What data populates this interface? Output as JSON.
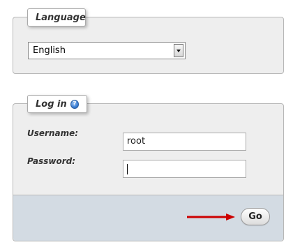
{
  "language_section": {
    "legend": "Language",
    "select": {
      "selected_value": "English"
    }
  },
  "login_section": {
    "legend": "Log in",
    "help_icon_glyph": "?",
    "username": {
      "label": "Username:",
      "value": "root"
    },
    "password": {
      "label": "Password:",
      "value": ""
    },
    "submit_label": "Go"
  },
  "colors": {
    "fieldset_bg": "#eeeeee",
    "footer_bg": "#d3dbe3",
    "arrow": "#cc0000",
    "help_icon": "#3a7fd6"
  },
  "icons": {
    "help": "help-circle-icon",
    "dropdown": "chevron-down-icon",
    "pointer": "arrow-right-icon"
  }
}
